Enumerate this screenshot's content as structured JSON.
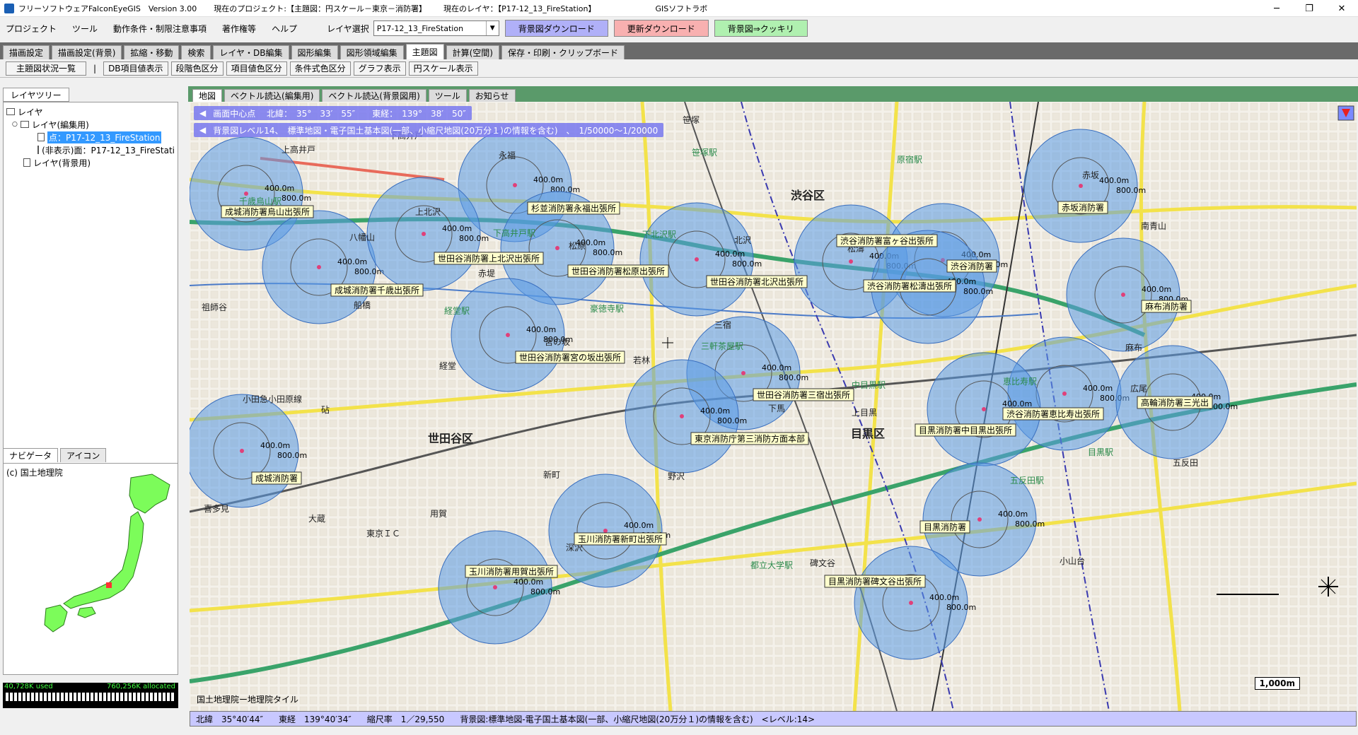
{
  "titlebar": {
    "app": "フリーソフトウェアFalconEyeGIS　Version 3.00",
    "project": "現在のプロジェクト:【主題図：円スケール－東京－消防署】",
    "layer": "現在のレイヤ：【P17-12_13_FireStation】",
    "vendor": "GISソフトラボ"
  },
  "menubar": {
    "items": [
      "プロジェクト",
      "ツール",
      "動作条件・制限注意事項",
      "著作権等",
      "ヘルプ"
    ],
    "layer_select_label": "レイヤ選択",
    "layer_select_value": "P17-12_13_FireStation",
    "btn_bg_download": "背景図ダウンロード",
    "btn_update_download": "更新ダウンロード",
    "btn_bg_sharp": "背景図⇒クッキリ"
  },
  "main_tabs": [
    "描画設定",
    "描画設定(背景)",
    "拡縮・移動",
    "検索",
    "レイヤ・DB編集",
    "図形編集",
    "図形領域編集",
    "主題図",
    "計算(空間)",
    "保存・印刷・クリップボード"
  ],
  "sub_buttons": [
    "主題図状況一覧",
    "DB項目値表示",
    "段階色区分",
    "項目値色区分",
    "条件式色区分",
    "グラフ表示",
    "円スケール表示"
  ],
  "sub_sep": "|",
  "leftpane": {
    "tab": "レイヤツリー",
    "tree": [
      "レイヤ",
      "レイヤ(編集用)",
      "点：P17-12_13_FireStation",
      "(非表示)面：P17-12_13_FireStati",
      "レイヤ(背景用)"
    ],
    "nav_tabs": [
      "ナビゲータ",
      "アイコン"
    ],
    "nav_credit": "(c) 国土地理院",
    "mem_used": "40,728K used",
    "mem_alloc": "760,256K allocated"
  },
  "map_tabs": [
    "地図",
    "ベクトル読込(編集用)",
    "ベクトル読込(背景図用)",
    "ツール",
    "お知らせ"
  ],
  "map": {
    "center_pill": "画面中心点　 北緯：　35°　33′　55″　　東経：　139°　38′　50″",
    "bg_pill": "背景図レベル14、　標準地図・電子国土基本図(一部、小縮尺地図(20万分１)の情報を含む)　、　1/50000～1/20000",
    "credit": "国土地理院ー地理院タイル",
    "scale_label": "1,000m",
    "stations": [
      {
        "name": "成城消防署烏山出張所"
      },
      {
        "name": "成城消防署千歳出張所"
      },
      {
        "name": "杉並消防署永福出張所"
      },
      {
        "name": "世田谷消防署上北沢出張所"
      },
      {
        "name": "世田谷消防署松原出張所"
      },
      {
        "name": "世田谷消防署宮の坂出張所"
      },
      {
        "name": "世田谷消防署北沢出張所"
      },
      {
        "name": "渋谷消防署富ヶ谷出張所"
      },
      {
        "name": "渋谷消防署"
      },
      {
        "name": "渋谷消防署松濤出張所"
      },
      {
        "name": "赤坂消防署"
      },
      {
        "name": "麻布消防署"
      },
      {
        "name": "世田谷消防署三宿出張所"
      },
      {
        "name": "東京消防庁第三消防方面本部"
      },
      {
        "name": "渋谷消防署恵比寿出張所"
      },
      {
        "name": "高輪消防署三光出"
      },
      {
        "name": "目黒消防署中目黒出張所"
      },
      {
        "name": "成城消防署"
      },
      {
        "name": "玉川消防署新町出張所"
      },
      {
        "name": "玉川消防署用賀出張所"
      },
      {
        "name": "目黒消防署"
      },
      {
        "name": "目黒消防署碑文谷出張所"
      }
    ],
    "radius_labels": [
      "400.0m",
      "800.0m"
    ],
    "place_labels": [
      "上高井戸",
      "下高井戸",
      "永福",
      "笹塚",
      "笹塚駅",
      "原宿駅",
      "渋谷区",
      "赤坂",
      "南青山",
      "千歳烏山駅",
      "上北沢",
      "八幡山",
      "下高井戸駅",
      "松原",
      "下北沢駅",
      "北沢",
      "松濤",
      "祖師谷",
      "船橋",
      "赤堤",
      "豪徳寺駅",
      "経堂駅",
      "経堂",
      "宮の坂",
      "若林",
      "三宿",
      "三軒茶屋駅",
      "麻布",
      "中目黒駅",
      "上目黒",
      "目黒区",
      "五反田",
      "小田急小田原線",
      "砧",
      "世田谷区",
      "下馬",
      "野沢",
      "喜多見",
      "大蔵",
      "用賀",
      "新町",
      "東京ＩＣ",
      "深沢",
      "碑文谷",
      "都立大学駅",
      "小山台",
      "五反田駅",
      "目黒駅",
      "恵比寿駅",
      "広尾"
    ]
  },
  "statusbar": {
    "lat": "北緯　35°40′44″",
    "lon": "東経　139°40′34″",
    "scale": "縮尺率　1／29,550",
    "bg": "背景図:標準地図-電子国土基本図(一部、小縮尺地図(20万分１)の情報を含む)　<レベル:14>"
  },
  "colors": {
    "circle_fill": "#5a9be6",
    "label_bg": "#ffffcc",
    "status_bg": "#c8c8ff"
  }
}
